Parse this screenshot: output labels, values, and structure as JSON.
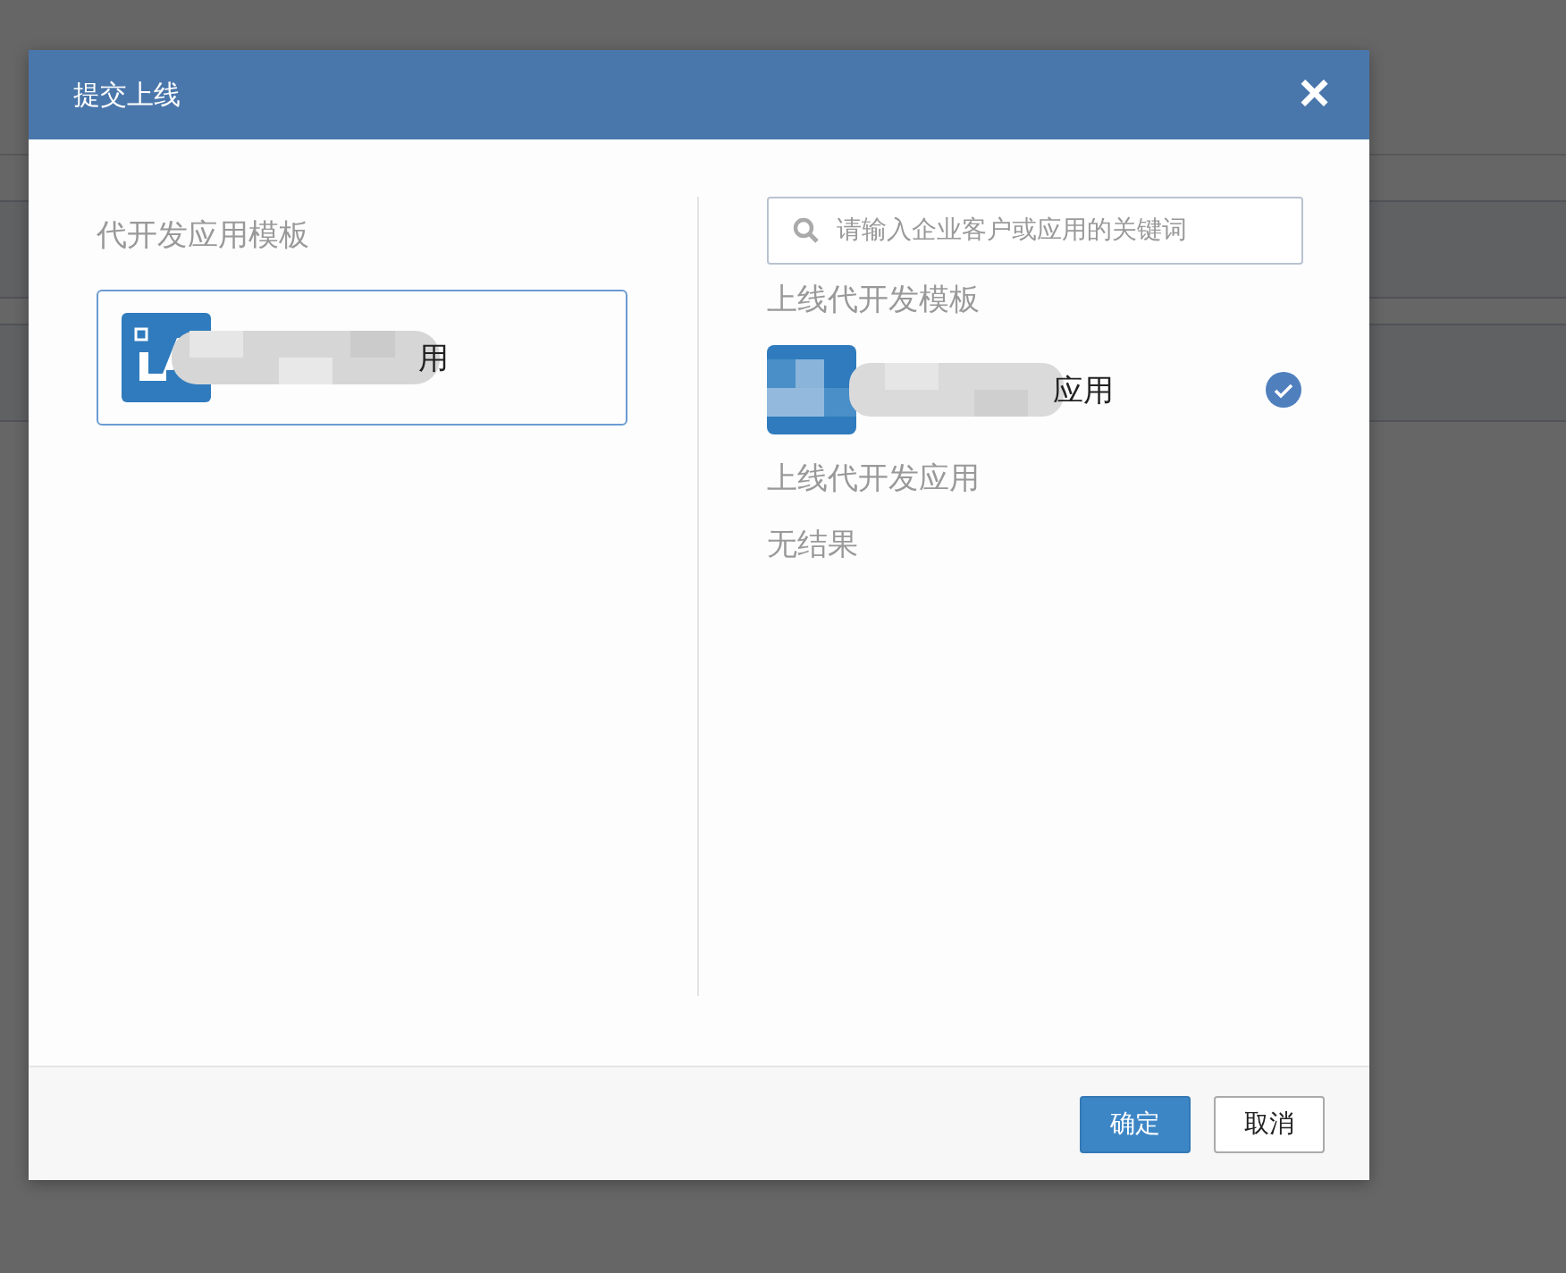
{
  "dialog": {
    "title": "提交上线",
    "close": "×",
    "templates": {
      "heading": "代开发应用模板",
      "items": [
        {
          "name": "用",
          "selected": true
        }
      ]
    },
    "search": {
      "placeholder": "请输入企业客户或应用的关键词"
    },
    "sections": [
      {
        "heading": "上线代开发模板",
        "items": [
          {
            "name": "应用",
            "checked": true
          }
        ]
      },
      {
        "heading": "上线代开发应用",
        "empty": "无结果"
      }
    ],
    "buttons": [
      {
        "label": "确定",
        "kind": "primary"
      },
      {
        "label": "取消",
        "kind": "default"
      }
    ]
  }
}
